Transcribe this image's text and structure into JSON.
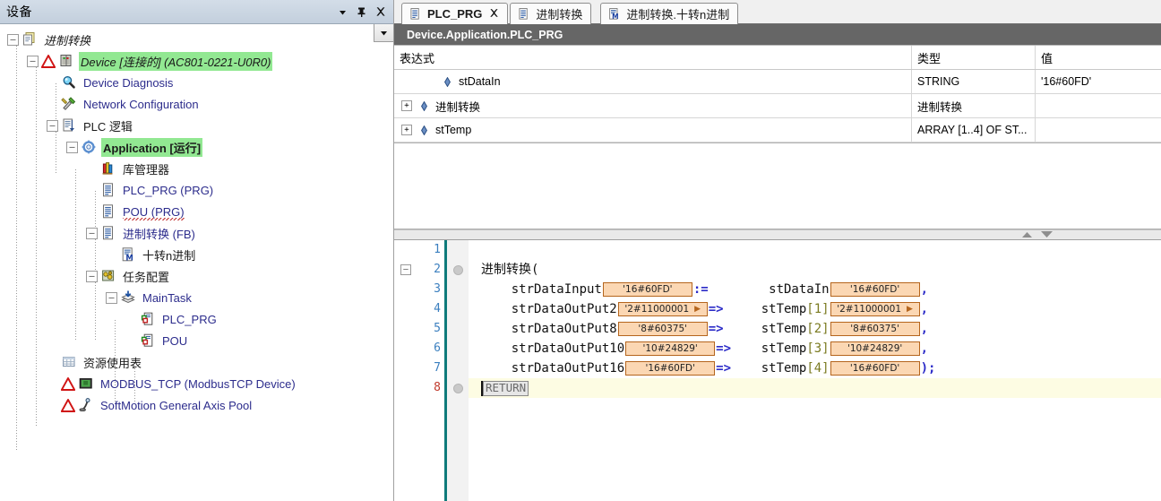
{
  "devices_panel": {
    "title": "设备",
    "buttons": [
      {
        "name": "dropdown",
        "glyph": "▼"
      },
      {
        "name": "pin",
        "glyph": "pin-icon"
      },
      {
        "name": "close",
        "glyph": "✕"
      }
    ],
    "tree_dropdown_glyph": "▼",
    "tree": [
      {
        "label": "进制转换",
        "depth": 0,
        "icon": "project-icon",
        "expander": "-",
        "style": "italic",
        "selected": false,
        "warn": false
      },
      {
        "label": "Device [连接的] (AC801-0221-U0R0)",
        "depth": 1,
        "icon": "device-icon",
        "expander": "-",
        "style": "italic",
        "selected": true,
        "warn": true
      },
      {
        "label": "Device Diagnosis",
        "depth": 2,
        "icon": "diagnosis-icon",
        "expander": "",
        "style": "link",
        "selected": false,
        "warn": false
      },
      {
        "label": "Network Configuration",
        "depth": 2,
        "icon": "network-config-icon",
        "expander": "",
        "style": "link",
        "selected": false,
        "warn": false
      },
      {
        "label": "PLC 逻辑",
        "depth": 2,
        "icon": "plc-logic-icon",
        "expander": "-",
        "style": "plain",
        "selected": false,
        "warn": false
      },
      {
        "label": "Application [运行]",
        "depth": 3,
        "icon": "application-icon",
        "expander": "-",
        "style": "bold",
        "selected": true,
        "warn": false
      },
      {
        "label": "库管理器",
        "depth": 4,
        "icon": "library-icon",
        "expander": "",
        "style": "plain",
        "selected": false,
        "warn": false
      },
      {
        "label": "PLC_PRG (PRG)",
        "depth": 4,
        "icon": "pou-icon",
        "expander": "",
        "style": "link",
        "selected": false,
        "warn": false
      },
      {
        "label": "POU (PRG)",
        "depth": 4,
        "icon": "pou-icon",
        "expander": "",
        "style": "link-squiggle",
        "selected": false,
        "warn": false
      },
      {
        "label": "进制转换 (FB)",
        "depth": 4,
        "icon": "pou-icon",
        "expander": "-",
        "style": "plain-link",
        "selected": false,
        "warn": false
      },
      {
        "label": "十转n进制",
        "depth": 5,
        "icon": "method-icon",
        "expander": "",
        "style": "plain",
        "selected": false,
        "warn": false
      },
      {
        "label": "任务配置",
        "depth": 4,
        "icon": "task-config-icon",
        "expander": "-",
        "style": "plain",
        "selected": false,
        "warn": false
      },
      {
        "label": "MainTask",
        "depth": 5,
        "icon": "task-icon",
        "expander": "-",
        "style": "link",
        "selected": false,
        "warn": false
      },
      {
        "label": "PLC_PRG",
        "depth": 6,
        "icon": "task-call-icon",
        "expander": "",
        "style": "link",
        "selected": false,
        "warn": false
      },
      {
        "label": "POU",
        "depth": 6,
        "icon": "task-call-icon",
        "expander": "",
        "style": "link",
        "selected": false,
        "warn": false
      },
      {
        "label": "资源使用表",
        "depth": 2,
        "icon": "resource-table-icon",
        "expander": "",
        "style": "plain",
        "selected": false,
        "warn": false
      },
      {
        "label": "MODBUS_TCP (ModbusTCP Device)",
        "depth": 2,
        "icon": "modbus-icon",
        "expander": "",
        "style": "link",
        "selected": false,
        "warn": true
      },
      {
        "label": "SoftMotion General Axis Pool",
        "depth": 2,
        "icon": "axis-pool-icon",
        "expander": "",
        "style": "link",
        "selected": false,
        "warn": true
      }
    ]
  },
  "editor": {
    "tabs": [
      {
        "label": "PLC_PRG",
        "icon": "pou-icon",
        "active": true,
        "closable": true
      },
      {
        "label": "进制转换",
        "icon": "pou-icon",
        "active": false,
        "closable": false
      },
      {
        "label": "进制转换.十转n进制",
        "icon": "method-icon",
        "active": false,
        "closable": false
      }
    ],
    "tab_close_glyph": "✕",
    "object_path": "Device.Application.PLC_PRG",
    "watch_table": {
      "headers": [
        "表达式",
        "类型",
        "值"
      ],
      "rows": [
        {
          "expander": "",
          "expression": "stDataIn",
          "type": "STRING",
          "value": "'16#60FD'",
          "indent": 1
        },
        {
          "expander": "+",
          "expression": "进制转换",
          "type": "进制转换",
          "value": "",
          "indent": 0
        },
        {
          "expander": "+",
          "expression": "stTemp",
          "type": "ARRAY [1..4] OF ST...",
          "value": "",
          "indent": 0
        }
      ]
    },
    "splitter": {
      "up_glyph": "▲",
      "down_glyph": "▼"
    },
    "code": {
      "lines": [
        {
          "num": "1",
          "fold": "",
          "marker": false,
          "highlight": false,
          "segments": []
        },
        {
          "num": "2",
          "fold": "-",
          "marker": true,
          "highlight": false,
          "segments": [
            {
              "t": "text",
              "v": "进制转换("
            }
          ]
        },
        {
          "num": "3",
          "fold": "",
          "marker": false,
          "highlight": false,
          "segments": [
            {
              "t": "text",
              "v": "    strDataInput"
            },
            {
              "t": "inline",
              "v": "'16#60FD'",
              "w": 100,
              "arrow": false
            },
            {
              "t": "op",
              "v": ":="
            },
            {
              "t": "text",
              "v": "        stDataIn"
            },
            {
              "t": "inline",
              "v": "'16#60FD'",
              "w": 100,
              "arrow": false
            },
            {
              "t": "op",
              "v": ","
            }
          ]
        },
        {
          "num": "4",
          "fold": "",
          "marker": false,
          "highlight": false,
          "segments": [
            {
              "t": "text",
              "v": "    strDataOutPut2"
            },
            {
              "t": "inline",
              "v": "'2#11000001",
              "w": 100,
              "arrow": true
            },
            {
              "t": "op",
              "v": "=>"
            },
            {
              "t": "text",
              "v": "     stTemp"
            },
            {
              "t": "idx",
              "v": "[1]"
            },
            {
              "t": "inline",
              "v": "'2#11000001",
              "w": 100,
              "arrow": true
            },
            {
              "t": "op",
              "v": ","
            }
          ]
        },
        {
          "num": "5",
          "fold": "",
          "marker": false,
          "highlight": false,
          "segments": [
            {
              "t": "text",
              "v": "    strDataOutPut8"
            },
            {
              "t": "inline",
              "v": "'8#60375'",
              "w": 100,
              "arrow": false
            },
            {
              "t": "op",
              "v": "=>"
            },
            {
              "t": "text",
              "v": "     stTemp"
            },
            {
              "t": "idx",
              "v": "[2]"
            },
            {
              "t": "inline",
              "v": "'8#60375'",
              "w": 100,
              "arrow": false
            },
            {
              "t": "op",
              "v": ","
            }
          ]
        },
        {
          "num": "6",
          "fold": "",
          "marker": false,
          "highlight": false,
          "segments": [
            {
              "t": "text",
              "v": "    strDataOutPut10"
            },
            {
              "t": "inline",
              "v": "'10#24829'",
              "w": 100,
              "arrow": false
            },
            {
              "t": "op",
              "v": "=>"
            },
            {
              "t": "text",
              "v": "    stTemp"
            },
            {
              "t": "idx",
              "v": "[3]"
            },
            {
              "t": "inline",
              "v": "'10#24829'",
              "w": 100,
              "arrow": false
            },
            {
              "t": "op",
              "v": ","
            }
          ]
        },
        {
          "num": "7",
          "fold": "",
          "marker": false,
          "highlight": false,
          "segments": [
            {
              "t": "text",
              "v": "    strDataOutPut16"
            },
            {
              "t": "inline",
              "v": "'16#60FD'",
              "w": 100,
              "arrow": false
            },
            {
              "t": "op",
              "v": "=>"
            },
            {
              "t": "text",
              "v": "    stTemp"
            },
            {
              "t": "idx",
              "v": "[4]"
            },
            {
              "t": "inline",
              "v": "'16#60FD'",
              "w": 100,
              "arrow": false
            },
            {
              "t": "op",
              "v": ");"
            }
          ]
        },
        {
          "num": "8",
          "fold": "",
          "marker": true,
          "highlight": true,
          "error_num": true,
          "segments": [
            {
              "t": "caret",
              "v": ""
            },
            {
              "t": "retbox",
              "v": "RETURN"
            }
          ]
        }
      ]
    }
  },
  "colors": {
    "selection_green": "#92e892",
    "panel_header": "#c9d5e2",
    "objpath_bg": "#666666",
    "inline_value_bg": "#fbd7b3",
    "inline_value_border": "#b5651d",
    "highlight_line": "#fdfce3",
    "gutter_number": "#3b7fbf",
    "error_number": "#c0392b",
    "link_text": "#2c2c8c",
    "vbar_teal": "#0e7a7a"
  }
}
